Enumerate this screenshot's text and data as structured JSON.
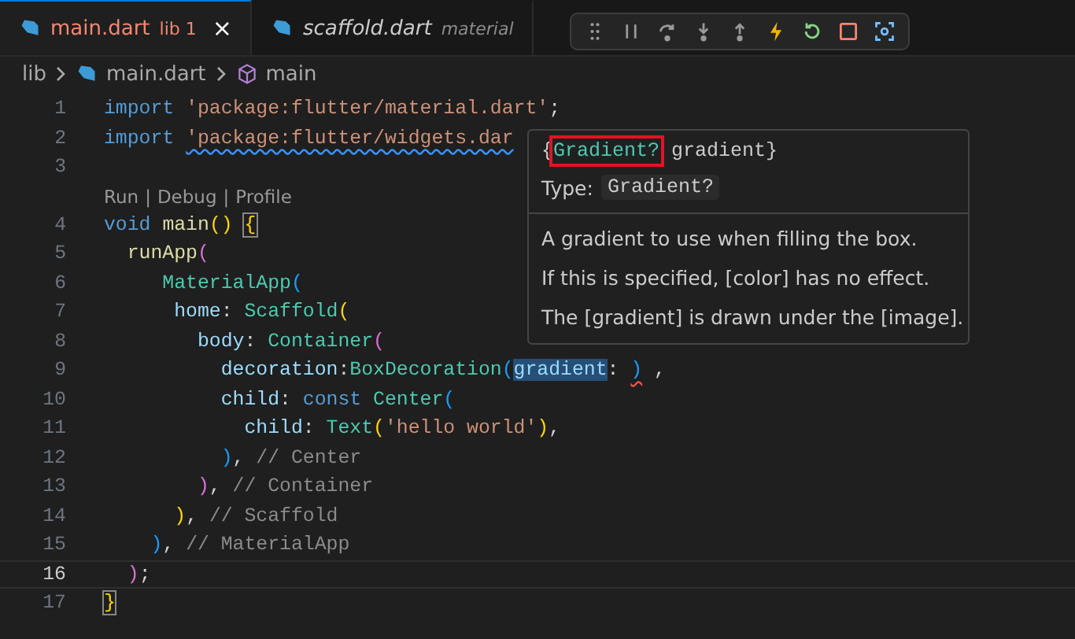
{
  "tabs": [
    {
      "name": "main.dart",
      "detail": "lib 1",
      "selected": true,
      "error": true,
      "close": "×"
    },
    {
      "name": "scaffold.dart",
      "detail": "material",
      "selected": false,
      "error": false
    }
  ],
  "breadcrumb": [
    "lib",
    "main.dart",
    "main"
  ],
  "lines": [
    {
      "number": "1",
      "current": false,
      "tokens": [
        {
          "text": "import ",
          "kind": "keyword"
        },
        {
          "text": "'package:flutter/material.dart'",
          "kind": "string"
        },
        {
          "text": ";",
          "kind": "plain"
        }
      ]
    },
    {
      "number": "2",
      "current": false,
      "tokens": [
        {
          "text": "import ",
          "kind": "keyword"
        },
        {
          "text": "'package:flutter/widgets.dar",
          "kind": "string",
          "warning": true
        }
      ]
    },
    {
      "number": "3",
      "current": false
    },
    {
      "number": "4",
      "current": false,
      "codelens": {
        "items": [
          "Run",
          "Debug",
          "Profile"
        ],
        "separator": "|"
      },
      "tokens": [
        {
          "text": "void ",
          "kind": "keyword"
        },
        {
          "text": "main",
          "kind": "func"
        },
        {
          "text": "() ",
          "kind": "b1"
        },
        {
          "text": "{",
          "kind": "b1",
          "bracket_match": true
        }
      ]
    },
    {
      "number": "5",
      "current": false,
      "tokens": [
        {
          "text": "  runApp",
          "kind": "func"
        },
        {
          "text": "(",
          "kind": "b2"
        }
      ]
    },
    {
      "number": "6",
      "current": false,
      "tokens": [
        {
          "text": "     MaterialApp",
          "kind": "type"
        },
        {
          "text": "(",
          "kind": "b3"
        }
      ]
    },
    {
      "number": "7",
      "current": false,
      "tokens": [
        {
          "text": "      home",
          "kind": "prop"
        },
        {
          "text": ": ",
          "kind": "plain"
        },
        {
          "text": "Scaffold",
          "kind": "type"
        },
        {
          "text": "(",
          "kind": "b1"
        }
      ]
    },
    {
      "number": "8",
      "current": false,
      "tokens": [
        {
          "text": "        body",
          "kind": "prop"
        },
        {
          "text": ": ",
          "kind": "plain"
        },
        {
          "text": "Container",
          "kind": "type"
        },
        {
          "text": "(",
          "kind": "b2"
        }
      ]
    },
    {
      "number": "9",
      "current": false,
      "tokens": [
        {
          "text": "          decoration",
          "kind": "prop"
        },
        {
          "text": ":",
          "kind": "plain"
        },
        {
          "text": "BoxDecoration",
          "kind": "type"
        },
        {
          "text": "(",
          "kind": "b3"
        },
        {
          "text": "gradient",
          "kind": "prop",
          "highlighted": true
        },
        {
          "text": ": ",
          "kind": "plain"
        },
        {
          "text": ")",
          "kind": "b3",
          "error": true
        },
        {
          "text": " ,",
          "kind": "plain"
        }
      ]
    },
    {
      "number": "10",
      "current": false,
      "tokens": [
        {
          "text": "          child",
          "kind": "prop"
        },
        {
          "text": ": ",
          "kind": "plain"
        },
        {
          "text": "const ",
          "kind": "keyword"
        },
        {
          "text": "Center",
          "kind": "type"
        },
        {
          "text": "(",
          "kind": "b3"
        }
      ]
    },
    {
      "number": "11",
      "current": false,
      "tokens": [
        {
          "text": "            child",
          "kind": "prop"
        },
        {
          "text": ": ",
          "kind": "plain"
        },
        {
          "text": "Text",
          "kind": "type"
        },
        {
          "text": "(",
          "kind": "b1"
        },
        {
          "text": "'hello world'",
          "kind": "string"
        },
        {
          "text": ")",
          "kind": "b1"
        },
        {
          "text": ",",
          "kind": "plain"
        }
      ]
    },
    {
      "number": "12",
      "current": false,
      "tokens": [
        {
          "text": "          )",
          "kind": "b3"
        },
        {
          "text": ", ",
          "kind": "plain"
        },
        {
          "text": "// Center",
          "kind": "comment"
        }
      ]
    },
    {
      "number": "13",
      "current": false,
      "tokens": [
        {
          "text": "        )",
          "kind": "b2"
        },
        {
          "text": ", ",
          "kind": "plain"
        },
        {
          "text": "// Container",
          "kind": "comment"
        }
      ]
    },
    {
      "number": "14",
      "current": false,
      "tokens": [
        {
          "text": "      )",
          "kind": "b1"
        },
        {
          "text": ", ",
          "kind": "plain"
        },
        {
          "text": "// Scaffold",
          "kind": "comment"
        }
      ]
    },
    {
      "number": "15",
      "current": false,
      "tokens": [
        {
          "text": "    )",
          "kind": "b3"
        },
        {
          "text": ", ",
          "kind": "plain"
        },
        {
          "text": "// MaterialApp",
          "kind": "comment"
        }
      ]
    },
    {
      "number": "16",
      "current": true,
      "tokens": [
        {
          "text": "  )",
          "kind": "b2"
        },
        {
          "text": ";",
          "kind": "plain"
        }
      ]
    },
    {
      "number": "17",
      "current": false,
      "tokens": [
        {
          "text": "}",
          "kind": "b1",
          "bracket_match": true
        }
      ]
    }
  ],
  "hover": {
    "signature": [
      {
        "text": "{",
        "kind": "plain",
        "boxed": false
      },
      {
        "text": "Gradient?",
        "kind": "type",
        "boxed": true
      },
      {
        "text": " gradient}",
        "kind": "plain",
        "boxed": false
      }
    ],
    "type_label": "Type:",
    "type_value": "Gradient?",
    "paragraphs": [
      "A gradient to use when filling the box.",
      "If this is specified, [color] has no effect.",
      "The [gradient] is drawn under the [image]."
    ]
  }
}
